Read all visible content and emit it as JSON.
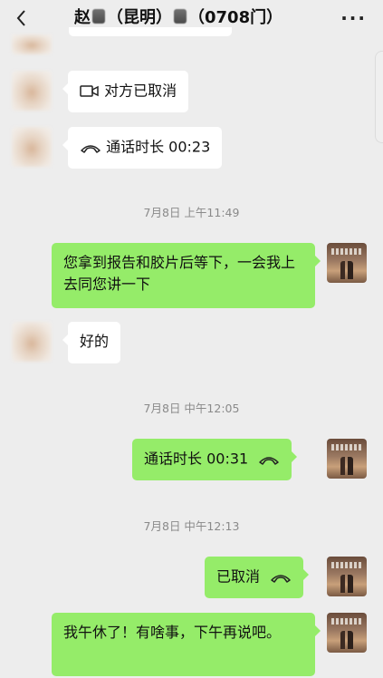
{
  "header": {
    "title_prefix": "赵",
    "title_mid": "（昆明）",
    "title_suffix": "（0708门",
    "title_paren": "）",
    "back_icon": "chevron-left-icon",
    "more_label": "···"
  },
  "messages": {
    "m1_text": "对方已取消",
    "m2_text": "通话时长 00:23",
    "ts1": "7月8日 上午11:49",
    "m3_text": "您拿到报告和胶片后等下，一会我上去同您讲一下",
    "m4_text": "好的",
    "ts2": "7月8日 中午12:05",
    "m5_text": "通话时长 00:31",
    "ts3": "7月8日 中午12:13",
    "m6_text": "已取消",
    "m7_text": "我午休了！有啥事，下午再说吧。"
  },
  "colors": {
    "background": "#ededed",
    "incoming_bubble": "#ffffff",
    "outgoing_bubble": "#95ec69"
  }
}
